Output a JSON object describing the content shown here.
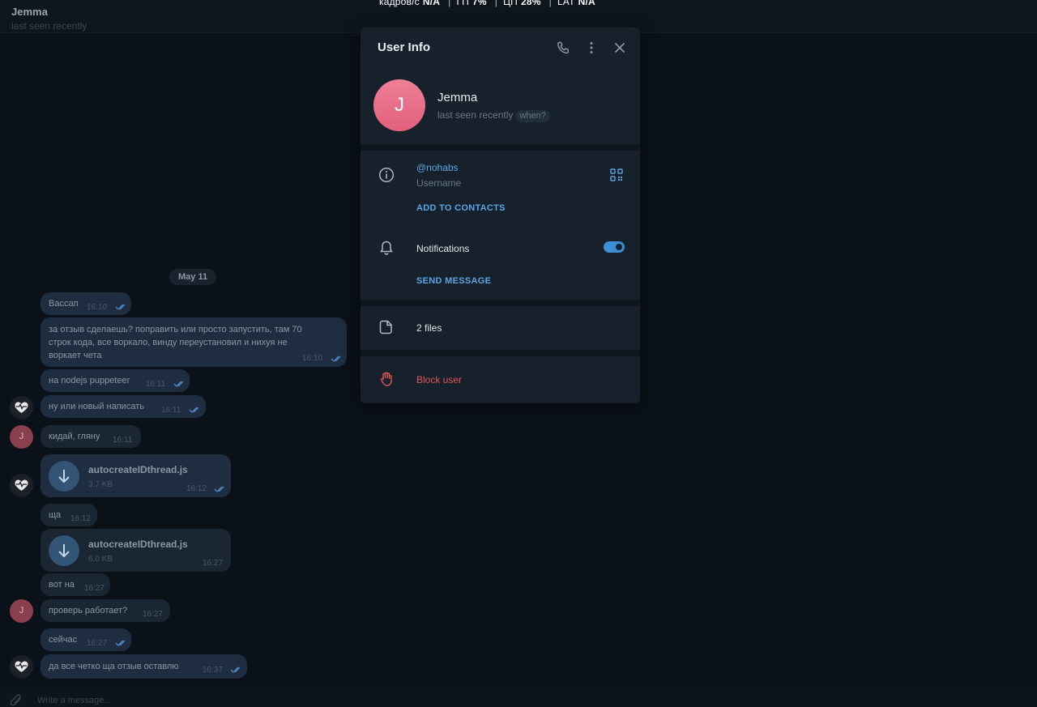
{
  "perf": {
    "fps_label": "кадров/с",
    "fps_value": "N/A",
    "gpu_label": "ГП",
    "gpu_value": "7%",
    "cpu_label": "ЦП",
    "cpu_value": "28%",
    "lat_label": "LAT",
    "lat_value": "N/A",
    "separator": "|"
  },
  "chat": {
    "name": "Jemma",
    "status": "last seen recently",
    "date": "May 11",
    "avatar_letter": "J",
    "messages": [
      {
        "text": "Вассап",
        "time": "16:10",
        "read": true
      },
      {
        "text": "за отзыв сделаешь? поправить или просто запустить, там 70 строк кода, все воркало, винду переустановил и нихуя не воркает чета",
        "time": "16:10",
        "read": true
      },
      {
        "text": "на nodejs puppeteer",
        "time": "16:11",
        "read": true
      },
      {
        "text": "ну или новый написать",
        "time": "16:11",
        "read": true
      },
      {
        "text": "кидай, гляну",
        "time": "16:11",
        "read": false
      },
      {
        "text": "ща",
        "time": "16:12",
        "read": false
      },
      {
        "text": "вот на",
        "time": "16:27",
        "read": false
      },
      {
        "text": "проверь работает?",
        "time": "16:27",
        "read": false
      },
      {
        "text": "сейчас",
        "time": "16:27",
        "read": true
      },
      {
        "text": "да все четко ща отзыв оставлю",
        "time": "16:37",
        "read": true
      }
    ],
    "files": [
      {
        "name": "autocreateIDthread.js",
        "size": "3.7 KB",
        "time": "16:12",
        "read": true
      },
      {
        "name": "autocreateIDthread.js",
        "size": "6.0 KB",
        "time": "16:27",
        "read": false
      }
    ],
    "composer_placeholder": "Write a message..."
  },
  "modal": {
    "title": "User Info",
    "name": "Jemma",
    "avatar_letter": "J",
    "seen": "last seen recently",
    "when": "when?",
    "username": "@nohabs",
    "username_label": "Username",
    "add_contacts": "ADD TO CONTACTS",
    "notifications": "Notifications",
    "notifications_on": true,
    "send_message": "SEND MESSAGE",
    "files": "2 files",
    "block": "Block user",
    "colors": {
      "accent": "#5aa6e6",
      "danger": "#e2535a",
      "avatar": "#ec6f8c"
    }
  }
}
